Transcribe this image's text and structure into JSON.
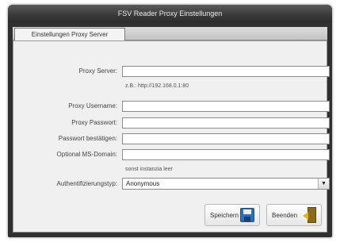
{
  "window": {
    "title": "FSV Reader Proxy Einstellungen"
  },
  "tabs": [
    {
      "label": "Einstellungen Proxy Server"
    }
  ],
  "form": {
    "proxy_server": {
      "label": "Proxy Server:",
      "value": ""
    },
    "proxy_hint": "z.B.: http://192.168.0.1:80",
    "proxy_username": {
      "label": "Proxy Username:",
      "value": ""
    },
    "proxy_password": {
      "label": "Proxy Passwort:",
      "value": ""
    },
    "password_confirm": {
      "label": "Passwort bestätigen:",
      "value": ""
    },
    "ms_domain": {
      "label": "Optional MS-Domain:",
      "value": ""
    },
    "domain_hint": "sonst instanzia leer",
    "auth_type": {
      "label": "Authentifizierungstyp:",
      "selected": "Anonymous"
    }
  },
  "buttons": {
    "save": "Speichern",
    "exit": "Beenden"
  },
  "icons": {
    "save": "floppy-disk-icon",
    "exit": "exit-door-icon",
    "dropdown": "chevron-down-icon"
  }
}
